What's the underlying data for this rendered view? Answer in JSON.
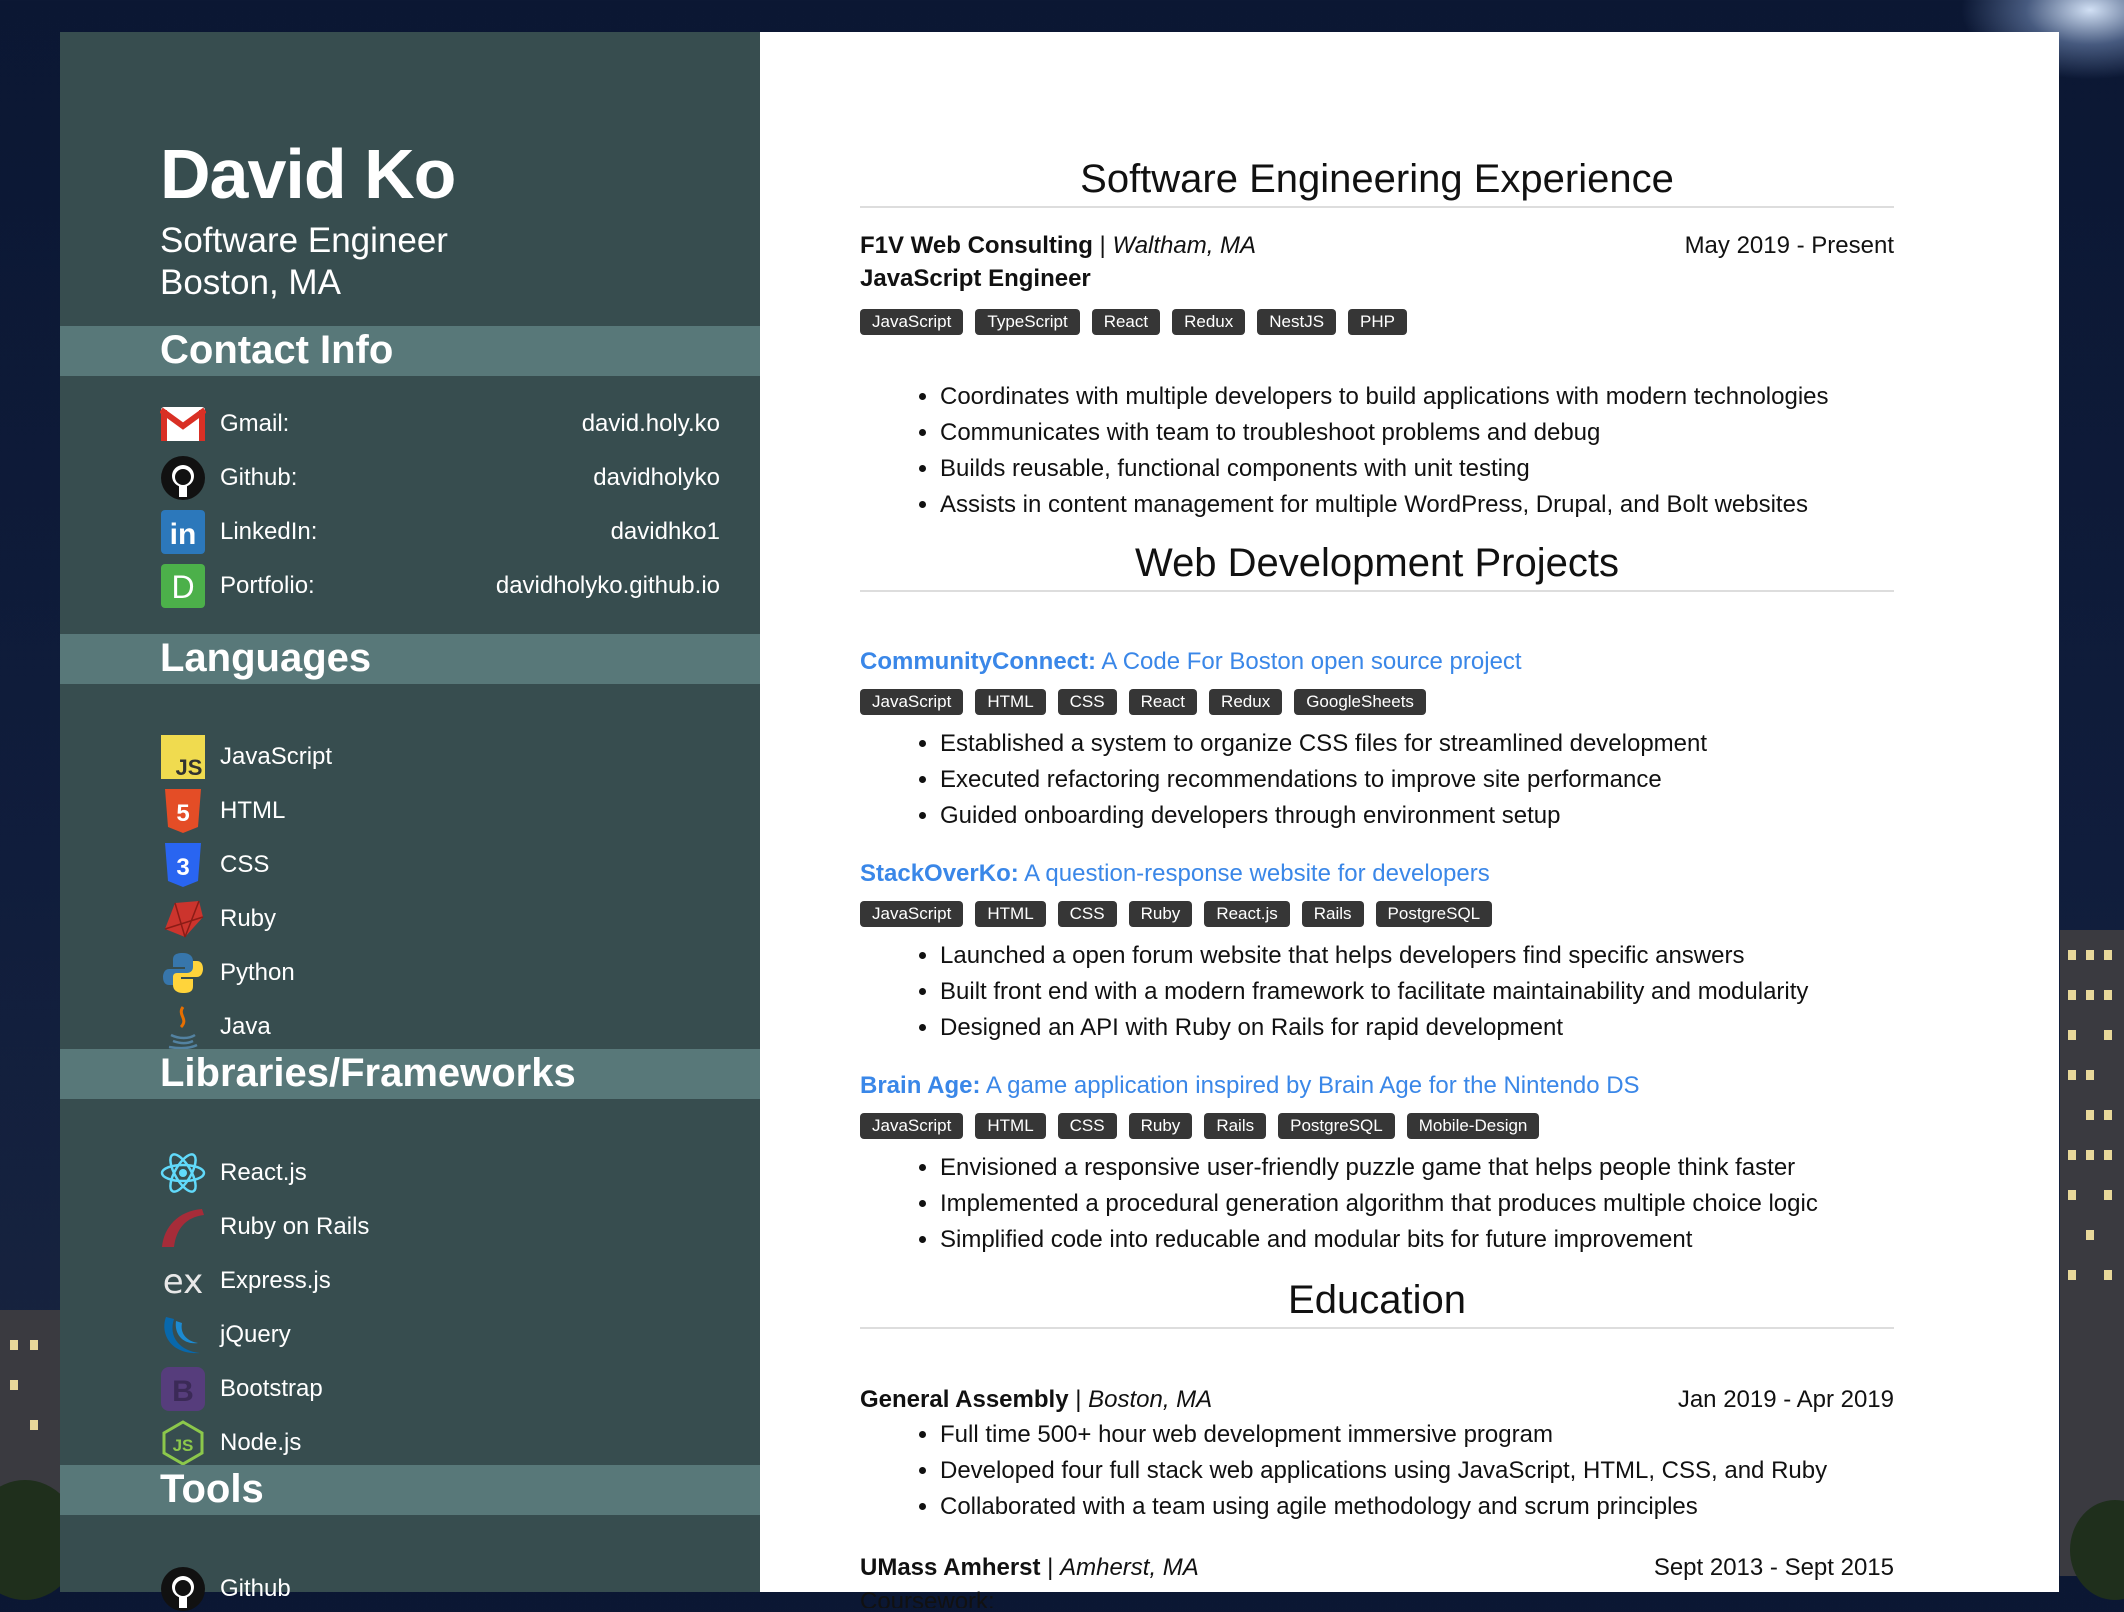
{
  "profile": {
    "name": "David Ko",
    "title": "Software Engineer",
    "location": "Boston, MA"
  },
  "sections": {
    "contact": "Contact Info",
    "languages": "Languages",
    "frameworks": "Libraries/Frameworks",
    "tools": "Tools"
  },
  "contact": [
    {
      "label": "Gmail:",
      "value": "david.holy.ko",
      "icon": "gmail-icon"
    },
    {
      "label": "Github:",
      "value": "davidholyko",
      "icon": "github-icon"
    },
    {
      "label": "LinkedIn:",
      "value": "davidhko1",
      "icon": "linkedin-icon"
    },
    {
      "label": "Portfolio:",
      "value": "davidholyko.github.io",
      "icon": "portfolio-icon"
    }
  ],
  "languages": [
    {
      "label": "JavaScript",
      "icon": "javascript-icon"
    },
    {
      "label": "HTML",
      "icon": "html5-icon"
    },
    {
      "label": "CSS",
      "icon": "css3-icon"
    },
    {
      "label": "Ruby",
      "icon": "ruby-icon"
    },
    {
      "label": "Python",
      "icon": "python-icon"
    },
    {
      "label": "Java",
      "icon": "java-icon"
    }
  ],
  "frameworks": [
    {
      "label": "React.js",
      "icon": "react-icon"
    },
    {
      "label": "Ruby on Rails",
      "icon": "rails-icon"
    },
    {
      "label": "Express.js",
      "icon": "express-icon"
    },
    {
      "label": "jQuery",
      "icon": "jquery-icon"
    },
    {
      "label": "Bootstrap",
      "icon": "bootstrap-icon"
    },
    {
      "label": "Node.js",
      "icon": "nodejs-icon"
    }
  ],
  "tools": [
    {
      "label": "Github",
      "icon": "github-icon"
    }
  ],
  "main": {
    "experience_title": "Software Engineering Experience",
    "job": {
      "company": "F1V Web Consulting",
      "sep": " | ",
      "location": "Waltham, MA",
      "dates": "May 2019 - Present",
      "role": "JavaScript Engineer",
      "tags": [
        "JavaScript",
        "TypeScript",
        "React",
        "Redux",
        "NestJS",
        "PHP"
      ],
      "bullets": [
        "Coordinates with multiple developers to build applications with modern technologies",
        "Communicates with team to troubleshoot problems and debug",
        "Builds reusable, functional components with unit testing",
        "Assists in content management for multiple WordPress, Drupal, and Bolt websites"
      ]
    },
    "projects_title": "Web Development Projects",
    "projects": [
      {
        "name": "CommunityConnect:",
        "desc": " A Code For Boston open source project",
        "tags": [
          "JavaScript",
          "HTML",
          "CSS",
          "React",
          "Redux",
          "GoogleSheets"
        ],
        "bullets": [
          "Established a system to organize CSS files for streamlined development",
          "Executed refactoring recommendations to improve site performance",
          "Guided onboarding developers through environment setup"
        ]
      },
      {
        "name": "StackOverKo:",
        "desc": " A question-response website for developers",
        "tags": [
          "JavaScript",
          "HTML",
          "CSS",
          "Ruby",
          "React.js",
          "Rails",
          "PostgreSQL"
        ],
        "bullets": [
          "Launched a open forum website that helps developers find specific answers",
          "Built front end with a modern framework to facilitate maintainability and modularity",
          "Designed an API with Ruby on Rails for rapid development"
        ]
      },
      {
        "name": "Brain Age:",
        "desc": " A game application inspired by Brain Age for the Nintendo DS",
        "tags": [
          "JavaScript",
          "HTML",
          "CSS",
          "Ruby",
          "Rails",
          "PostgreSQL",
          "Mobile-Design"
        ],
        "bullets": [
          "Envisioned a responsive user-friendly puzzle game that helps people think faster",
          "Implemented a procedural generation algorithm that produces multiple choice logic",
          "Simplified code into reducable and modular bits for future improvement"
        ]
      }
    ],
    "education_title": "Education",
    "education": [
      {
        "school": "General Assembly",
        "sep": " | ",
        "location": "Boston, MA",
        "dates": "Jan 2019 - Apr 2019",
        "bullets": [
          "Full time 500+ hour web development immersive program",
          "Developed four full stack web applications using JavaScript, HTML, CSS, and Ruby",
          "Collaborated with a team using agile methodology and scrum principles"
        ]
      },
      {
        "school": "UMass Amherst",
        "sep": " | ",
        "location": "Amherst, MA",
        "dates": "Sept 2013 - Sept 2015",
        "coursework": "Coursework:"
      }
    ]
  },
  "colors": {
    "sidebar": "#374d4f",
    "band": "#587879",
    "link": "#3a87e8",
    "tag": "#363636"
  }
}
